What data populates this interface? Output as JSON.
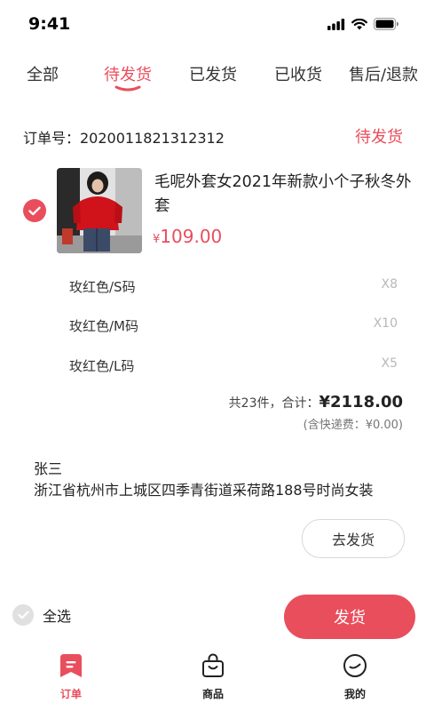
{
  "status_bar": {
    "time": "9:41"
  },
  "tabs": [
    {
      "label": "全部",
      "active": false
    },
    {
      "label": "待发货",
      "active": true
    },
    {
      "label": "已发货",
      "active": false
    },
    {
      "label": "已收货",
      "active": false
    },
    {
      "label": "售后/退款",
      "active": false
    }
  ],
  "order": {
    "number_label": "订单号：2020011821312312",
    "status": "待发货",
    "product": {
      "title": "毛呢外套女2021年新款小个子秋冬外套",
      "currency": "¥",
      "price": "109.00"
    },
    "variants": [
      {
        "name": "玫红色/S码",
        "qty": "X8"
      },
      {
        "name": "玫红色/M码",
        "qty": "X10"
      },
      {
        "name": "玫红色/L码",
        "qty": "X5"
      }
    ],
    "summary": {
      "count_text": "共23件，合计：",
      "total": "¥2118.00",
      "shipping": "(含快递费：¥0.00)"
    },
    "address": {
      "name": "张三",
      "line": "浙江省杭州市上城区四季青街道采荷路188号时尚女装"
    },
    "ship_button": "去发货"
  },
  "footer": {
    "select_all": "全选",
    "ship_button": "发货"
  },
  "nav": [
    {
      "label": "订单",
      "icon": "order-icon",
      "active": true
    },
    {
      "label": "商品",
      "icon": "bag-icon",
      "active": false
    },
    {
      "label": "我的",
      "icon": "profile-icon",
      "active": false
    }
  ],
  "colors": {
    "accent": "#e94e5c",
    "muted": "#b8b8b8"
  }
}
